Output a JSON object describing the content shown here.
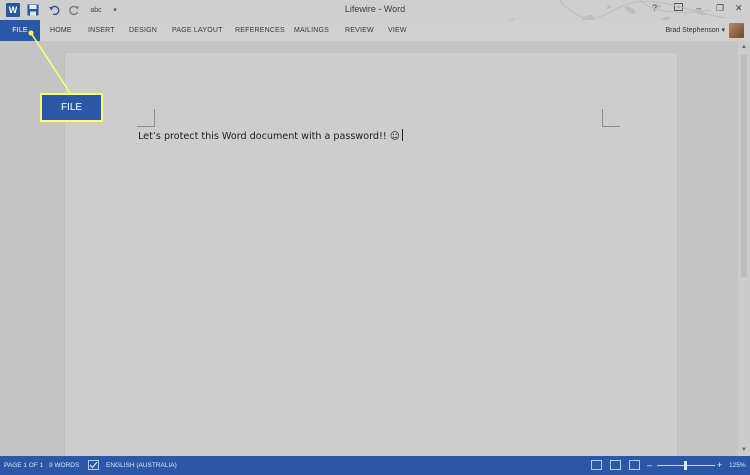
{
  "window": {
    "title": "Lifewire - Word",
    "help_label": "?",
    "minimize_label": "–",
    "restore_label": "❐",
    "close_label": "✕"
  },
  "quick_access": {
    "word_logo": "W",
    "spell_label": "abc",
    "more_label": "▾",
    "icons": [
      "word-logo",
      "save-icon",
      "undo-icon",
      "redo-icon",
      "spelling-icon",
      "customize-icon"
    ]
  },
  "ribbon": {
    "tabs": [
      "FILE",
      "HOME",
      "INSERT",
      "DESIGN",
      "PAGE LAYOUT",
      "REFERENCES",
      "MAILINGS",
      "REVIEW",
      "VIEW"
    ]
  },
  "user": {
    "name": "Brad Stephenson ▾"
  },
  "document": {
    "text": "Let’s protect this Word document with a password!! ☺"
  },
  "status": {
    "page": "PAGE 1 OF 1",
    "words": "9 WORDS",
    "language": "ENGLISH (AUSTRALIA)",
    "zoom_out": "–",
    "zoom_in": "+",
    "zoom": "125%"
  },
  "callout": {
    "label": "FILE"
  },
  "colors": {
    "accent": "#2a58a6",
    "callout_border": "#ffff66"
  }
}
